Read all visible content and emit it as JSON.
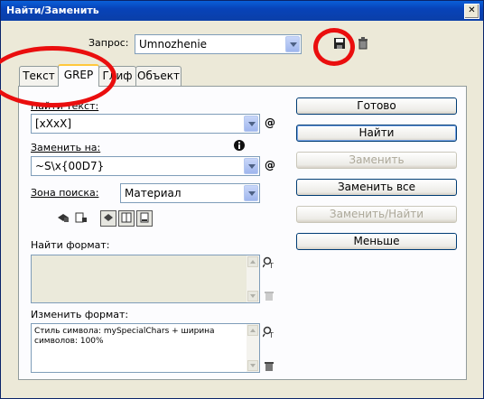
{
  "window": {
    "title": "Найти/Заменить",
    "close_glyph": "✕"
  },
  "query": {
    "label": "Запрос:",
    "value": "Umnozhenie"
  },
  "tabs": [
    {
      "label": "Текст",
      "active": false
    },
    {
      "label": "GREP",
      "active": true
    },
    {
      "label": "Глиф",
      "active": false
    },
    {
      "label": "Объект",
      "active": false
    }
  ],
  "find": {
    "label": "Найти текст:",
    "value": "[xXxX]"
  },
  "replace": {
    "label": "Заменить на:",
    "value": "~S\\x{00D7}"
  },
  "scope": {
    "label": "Зона поиска:",
    "value": "Материал"
  },
  "find_format": {
    "label": "Найти формат:",
    "value": ""
  },
  "change_format": {
    "label": "Изменить формат:",
    "value": "Стиль символа: mySpecialChars + ширина символов: 100%"
  },
  "buttons": {
    "done": "Готово",
    "find": "Найти",
    "replace": "Заменить",
    "replace_all": "Заменить все",
    "replace_find": "Заменить/Найти",
    "less": "Меньше"
  },
  "annotation_color": "#ea0e0e"
}
